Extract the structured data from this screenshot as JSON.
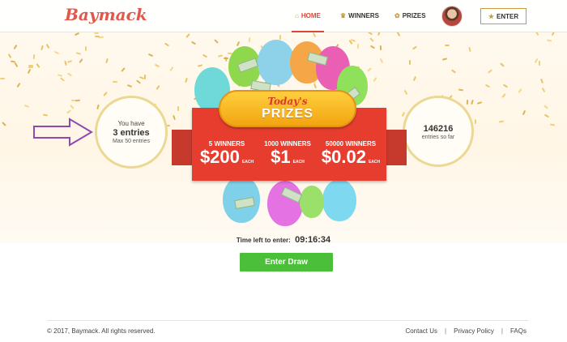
{
  "header": {
    "logo": "Baymack",
    "nav": [
      {
        "label": "HOME",
        "icon": "home-icon"
      },
      {
        "label": "WINNERS",
        "icon": "trophy-icon"
      },
      {
        "label": "PRIZES",
        "icon": "gift-icon"
      }
    ],
    "enter_label": "ENTER"
  },
  "entries": {
    "line1": "You have",
    "count": "3 entries",
    "max": "Max 50 entries"
  },
  "stats": {
    "count": "146216",
    "label": "entries so far"
  },
  "prizes": {
    "title_top": "Today's",
    "title_main": "PRIZES",
    "items": [
      {
        "winners": "5 WINNERS",
        "amount": "$200",
        "each": "EACH"
      },
      {
        "winners": "1000 WINNERS",
        "amount": "$1",
        "each": "EACH"
      },
      {
        "winners": "50000 WINNERS",
        "amount": "$0.02",
        "each": "EACH"
      }
    ]
  },
  "timer": {
    "label": "Time left to enter:",
    "value": "09:16:34"
  },
  "draw_button": "Enter Draw",
  "footer": {
    "copyright": "© 2017, Baymack. All rights reserved.",
    "links": [
      "Contact Us",
      "Privacy Policy",
      "FAQs"
    ],
    "separator": "|"
  },
  "colors": {
    "brand": "#e2574c",
    "accent_gold": "#c89b3c",
    "banner_red": "#e63d2f",
    "button_green": "#4bbf3a"
  }
}
